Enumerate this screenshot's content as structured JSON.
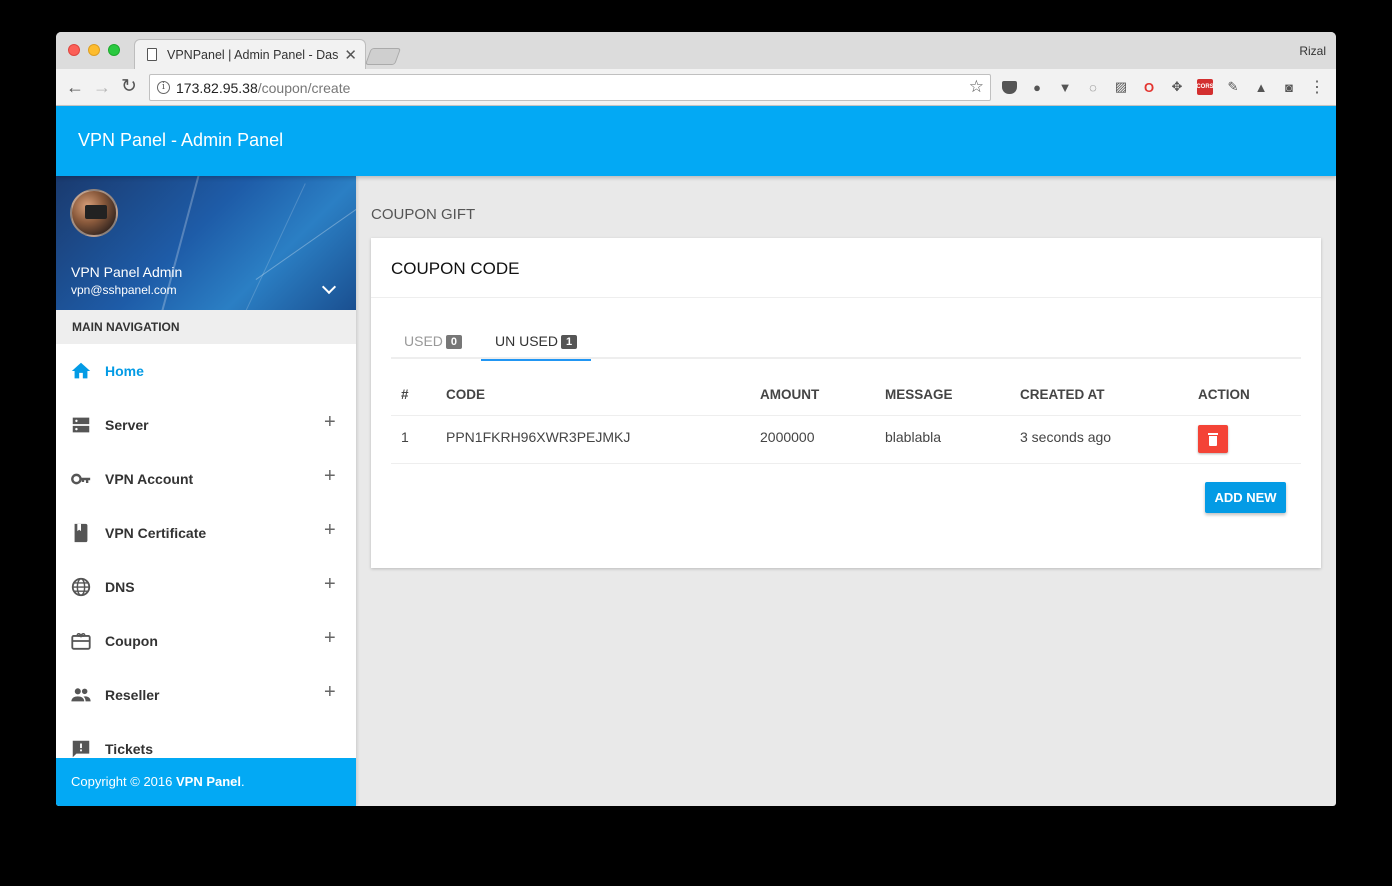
{
  "browser": {
    "tab_title": "VPNPanel | Admin Panel - Dashboard",
    "profile": "Rizal",
    "url_host": "173.82.95.38",
    "url_path": "/coupon/create"
  },
  "app": {
    "title": "VPN Panel - Admin Panel"
  },
  "user": {
    "name": "VPN Panel Admin",
    "email": "vpn@sshpanel.com"
  },
  "sidebar": {
    "nav_header": "MAIN NAVIGATION",
    "items": [
      {
        "label": "Home",
        "icon": "home-icon"
      },
      {
        "label": "Server",
        "icon": "server-icon"
      },
      {
        "label": "VPN Account",
        "icon": "key-icon"
      },
      {
        "label": "VPN Certificate",
        "icon": "book-icon"
      },
      {
        "label": "DNS",
        "icon": "globe-icon"
      },
      {
        "label": "Coupon",
        "icon": "gift-card-icon"
      },
      {
        "label": "Reseller",
        "icon": "group-icon"
      },
      {
        "label": "Tickets",
        "icon": "feedback-icon"
      }
    ],
    "plus": "+",
    "copyright_prefix": "Copyright © 2016 ",
    "copyright_brand": "VPN Panel",
    "copyright_suffix": "."
  },
  "main": {
    "page_title": "COUPON GIFT",
    "card_title": "COUPON CODE",
    "tabs": [
      {
        "label": "USED",
        "count": "0"
      },
      {
        "label": "UN USED",
        "count": "1"
      }
    ],
    "table": {
      "headers": [
        "#",
        "CODE",
        "AMOUNT",
        "MESSAGE",
        "CREATED AT",
        "ACTION"
      ],
      "rows": [
        {
          "num": "1",
          "code": "PPN1FKRH96XWR3PEJMKJ",
          "amount": "2000000",
          "message": "blablabla",
          "created_at": "3 seconds ago"
        }
      ]
    },
    "add_button": "ADD NEW"
  },
  "colors": {
    "primary": "#03a9f4",
    "danger": "#f44336"
  }
}
